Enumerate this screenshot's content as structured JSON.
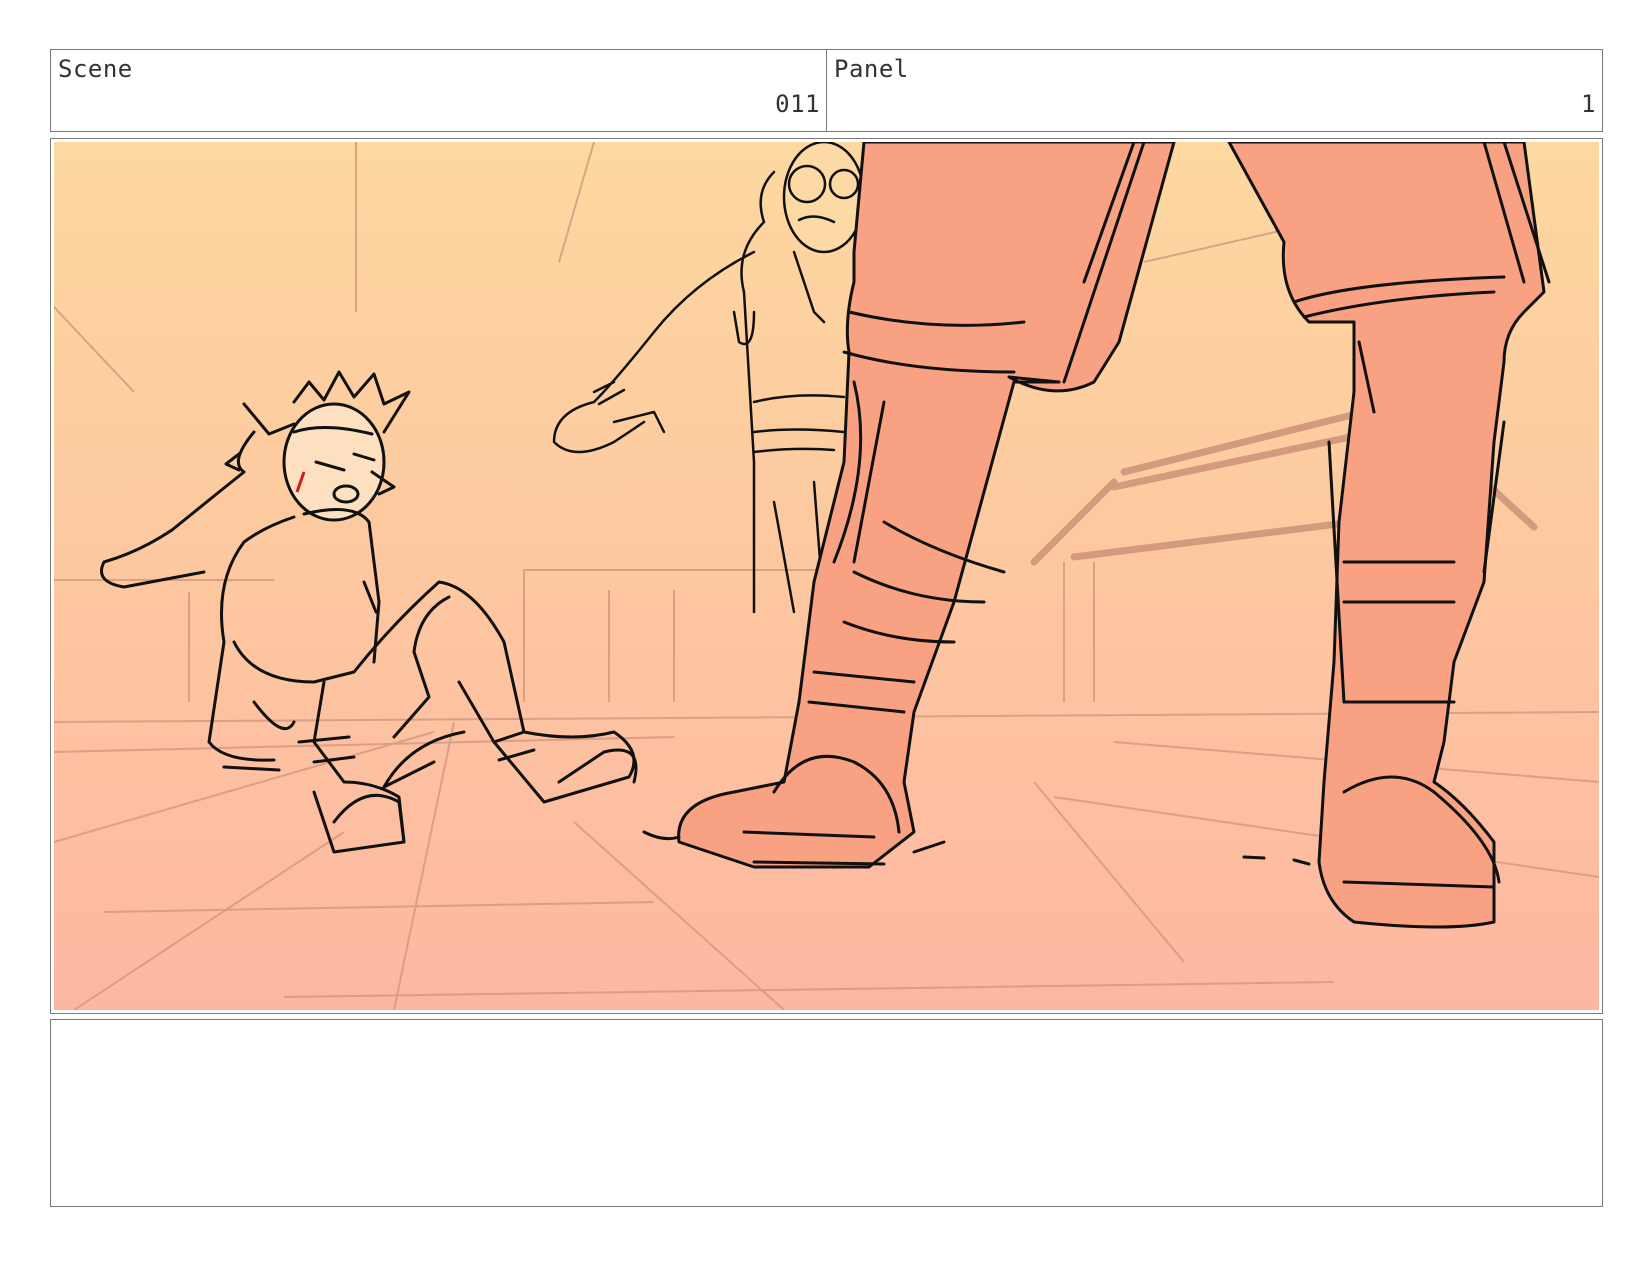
{
  "header": {
    "scene_label": "Scene",
    "scene_number": "011",
    "panel_label": "Panel",
    "panel_number": "1"
  },
  "colors": {
    "sky_top": "#fdd8a0",
    "floor_bottom": "#fdb7a1",
    "skin": "#f9a183",
    "line": "#111111",
    "guideline": "#d59a80",
    "nosebleed": "#d31e1e"
  },
  "notes": {
    "text": ""
  }
}
